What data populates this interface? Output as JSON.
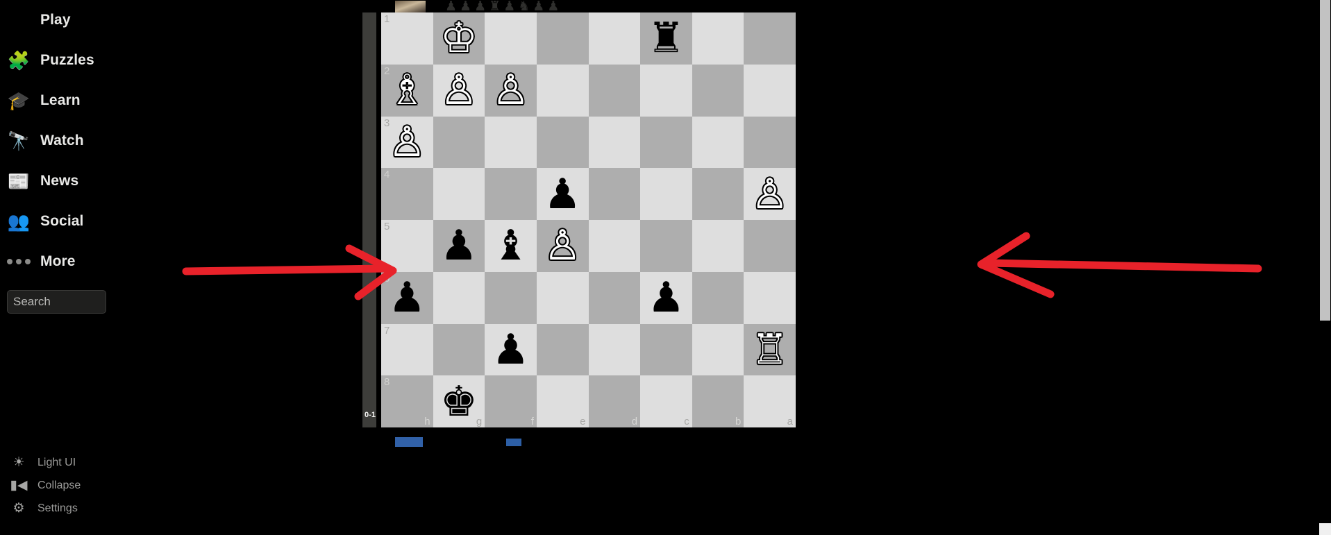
{
  "sidebar": {
    "nav_items": [
      {
        "label": "Play",
        "icon": "chess-pawn-icon",
        "glyph": "♟"
      },
      {
        "label": "Puzzles",
        "icon": "puzzle-piece-icon",
        "glyph": "🧩"
      },
      {
        "label": "Learn",
        "icon": "graduation-cap-icon",
        "glyph": "🎓"
      },
      {
        "label": "Watch",
        "icon": "binoculars-icon",
        "glyph": "🔭"
      },
      {
        "label": "News",
        "icon": "newspaper-icon",
        "glyph": "📰"
      },
      {
        "label": "Social",
        "icon": "people-icon",
        "glyph": "👥"
      },
      {
        "label": "More",
        "icon": "ellipsis-icon",
        "glyph": ""
      }
    ],
    "search": {
      "placeholder": "Search",
      "value": ""
    },
    "bottom_items": [
      {
        "label": "Light UI",
        "icon": "sun-icon",
        "glyph": "☀"
      },
      {
        "label": "Collapse",
        "icon": "collapse-left-icon",
        "glyph": "▮◀"
      },
      {
        "label": "Settings",
        "icon": "gear-icon",
        "glyph": "⚙"
      }
    ]
  },
  "board": {
    "score_label": "0-1",
    "orientation": "black",
    "rank_labels": [
      "1",
      "2",
      "3",
      "4",
      "5",
      "6",
      "7",
      "8"
    ],
    "file_labels": [
      "h",
      "g",
      "f",
      "e",
      "d",
      "c",
      "b",
      "a"
    ],
    "rows": [
      [
        {
          "p": ""
        },
        {
          "p": "white-king"
        },
        {
          "p": ""
        },
        {
          "p": ""
        },
        {
          "p": ""
        },
        {
          "p": "black-rook"
        },
        {
          "p": ""
        },
        {
          "p": ""
        }
      ],
      [
        {
          "p": "white-bishop"
        },
        {
          "p": "white-pawn"
        },
        {
          "p": "white-pawn"
        },
        {
          "p": ""
        },
        {
          "p": ""
        },
        {
          "p": ""
        },
        {
          "p": ""
        },
        {
          "p": ""
        }
      ],
      [
        {
          "p": "white-pawn"
        },
        {
          "p": ""
        },
        {
          "p": ""
        },
        {
          "p": ""
        },
        {
          "p": ""
        },
        {
          "p": ""
        },
        {
          "p": ""
        },
        {
          "p": ""
        }
      ],
      [
        {
          "p": ""
        },
        {
          "p": ""
        },
        {
          "p": ""
        },
        {
          "p": "black-pawn"
        },
        {
          "p": ""
        },
        {
          "p": ""
        },
        {
          "p": ""
        },
        {
          "p": "white-pawn"
        }
      ],
      [
        {
          "p": ""
        },
        {
          "p": "black-pawn"
        },
        {
          "p": "black-bishop"
        },
        {
          "p": "white-pawn"
        },
        {
          "p": ""
        },
        {
          "p": ""
        },
        {
          "p": ""
        },
        {
          "p": ""
        }
      ],
      [
        {
          "p": "black-pawn"
        },
        {
          "p": ""
        },
        {
          "p": ""
        },
        {
          "p": ""
        },
        {
          "p": ""
        },
        {
          "p": "black-pawn"
        },
        {
          "p": ""
        },
        {
          "p": ""
        }
      ],
      [
        {
          "p": ""
        },
        {
          "p": ""
        },
        {
          "p": "black-pawn"
        },
        {
          "p": ""
        },
        {
          "p": ""
        },
        {
          "p": ""
        },
        {
          "p": ""
        },
        {
          "p": "white-rook"
        }
      ],
      [
        {
          "p": ""
        },
        {
          "p": "black-king"
        },
        {
          "p": ""
        },
        {
          "p": ""
        },
        {
          "p": ""
        },
        {
          "p": ""
        },
        {
          "p": ""
        },
        {
          "p": ""
        }
      ]
    ],
    "captured_pieces": [
      "♟",
      "♟",
      "♟",
      "♜",
      "♟",
      "♞",
      "♟",
      "♟"
    ]
  },
  "annotations": {
    "left_arrow": {
      "direction": "right",
      "color": "#e8222a"
    },
    "right_arrow": {
      "direction": "left",
      "color": "#e8222a"
    }
  },
  "scrollbar": {
    "name": "vertical-scrollbar"
  }
}
